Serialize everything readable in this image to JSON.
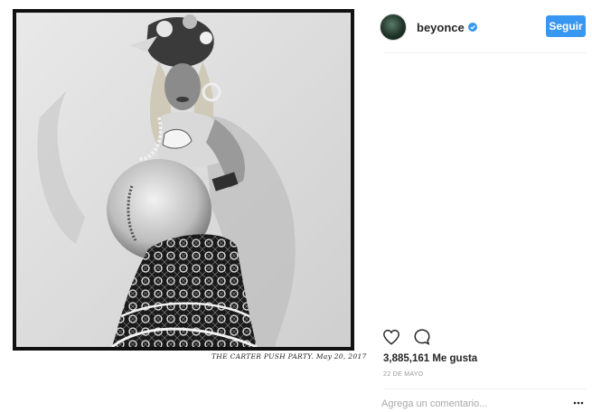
{
  "post": {
    "photo_caption_handwritten": "THE CARTER PUSH PARTY. May 20, 2017",
    "username": "beyonce",
    "follow_label": "Seguir",
    "likes": "3,885,161 Me gusta",
    "date": "22 DE MAYO",
    "comment_placeholder": "Agrega un comentario...",
    "icons": {
      "avatar": "avatar",
      "verified": "verified-badge-icon",
      "like": "heart-icon",
      "comment": "comment-bubble-icon",
      "more": "more-options-icon"
    },
    "colors": {
      "accent": "#3897f0",
      "text": "#262626",
      "muted": "#999999"
    }
  }
}
